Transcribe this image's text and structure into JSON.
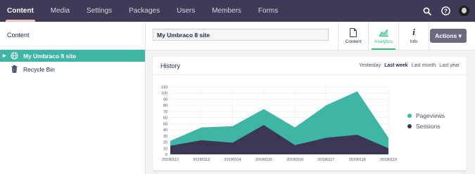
{
  "topbar": {
    "nav": [
      "Content",
      "Media",
      "Settings",
      "Packages",
      "Users",
      "Members",
      "Forms"
    ],
    "active_index": 0,
    "icons": [
      "search-icon",
      "help-icon",
      "avatar"
    ]
  },
  "sidebar": {
    "title": "Content",
    "items": [
      {
        "label": "My Umbraco 8 site",
        "icon": "globe-icon",
        "selected": true
      },
      {
        "label": "Recycle Bin",
        "icon": "trash-icon",
        "selected": false
      }
    ]
  },
  "editor": {
    "name_value": "My Umbraco 8 site",
    "apps": [
      {
        "label": "Content",
        "icon": "document-icon"
      },
      {
        "label": "Analytics",
        "icon": "chart-icon"
      },
      {
        "label": "Info",
        "icon": "info-icon"
      }
    ],
    "active_app": 1,
    "actions_label": "Actions ▾"
  },
  "card": {
    "title": "History",
    "ranges": [
      "Yesterday",
      "Last week",
      "Last month",
      "Last year"
    ],
    "active_range": 1
  },
  "colors": {
    "topbar": "#3f3a56",
    "accent": "#3fb5a6",
    "pageviews": "#3fb5a6",
    "sessions": "#3b3654"
  },
  "chart_data": {
    "type": "area",
    "x": [
      "20190112",
      "20190113",
      "20190114",
      "20190115",
      "20190116",
      "20190117",
      "20190118",
      "20190119"
    ],
    "ylim": [
      0,
      110
    ],
    "yticks": [
      0,
      10,
      20,
      30,
      40,
      50,
      60,
      70,
      80,
      90,
      100,
      110
    ],
    "series": [
      {
        "name": "Pageviews",
        "values": [
          22,
          44,
          46,
          74,
          44,
          80,
          103,
          27
        ]
      },
      {
        "name": "Sessions",
        "values": [
          14,
          23,
          19,
          48,
          15,
          27,
          32,
          10
        ]
      }
    ],
    "grid": true,
    "legend_position": "right"
  }
}
